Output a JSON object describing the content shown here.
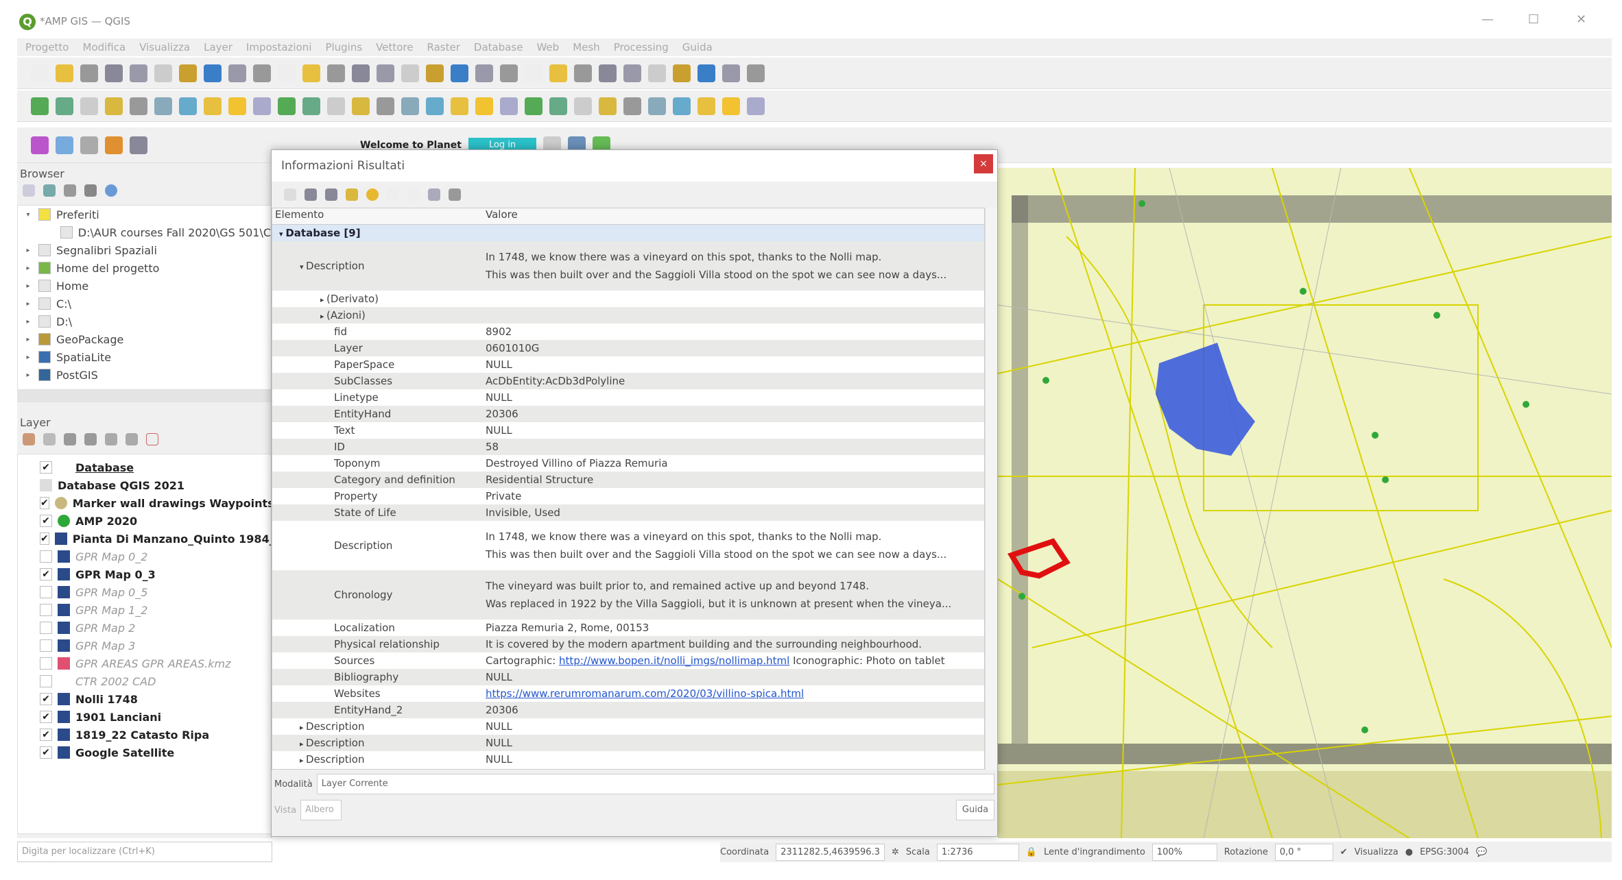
{
  "window": {
    "title": "*AMP GIS — QGIS"
  },
  "menu": [
    "Progetto",
    "Modifica",
    "Visualizza",
    "Layer",
    "Impostazioni",
    "Plugins",
    "Vettore",
    "Raster",
    "Database",
    "Web",
    "Mesh",
    "Processing",
    "Guida"
  ],
  "planet": {
    "welcome": "Welcome to Planet",
    "login": "Log in"
  },
  "browser": {
    "title": "Browser",
    "items": [
      {
        "label": "Preferiti",
        "expanded": true,
        "icon": "star-icon",
        "indent": 0
      },
      {
        "label": "D:\\AUR courses Fall 2020\\GS 501\\C",
        "icon": "folder-icon",
        "indent": 1
      },
      {
        "label": "Segnalibri Spaziali",
        "icon": "bookmark-icon",
        "indent": 0
      },
      {
        "label": "Home del progetto",
        "icon": "project-home-icon",
        "indent": 0
      },
      {
        "label": "Home",
        "icon": "home-icon",
        "indent": 0
      },
      {
        "label": "C:\\",
        "icon": "folder-icon",
        "indent": 0
      },
      {
        "label": "D:\\",
        "icon": "folder-icon",
        "indent": 0
      },
      {
        "label": "GeoPackage",
        "icon": "geopackage-icon",
        "indent": 0
      },
      {
        "label": "SpatiaLite",
        "icon": "spatialite-icon",
        "indent": 0
      },
      {
        "label": "PostGIS",
        "icon": "postgis-icon",
        "indent": 0
      }
    ]
  },
  "layers": {
    "title": "Layer",
    "items": [
      {
        "label": "Database",
        "checked": true,
        "active": true
      },
      {
        "label": "Database QGIS 2021",
        "checked": null
      },
      {
        "label": "Marker wall drawings Waypoints",
        "checked": true
      },
      {
        "label": "AMP 2020",
        "checked": true
      },
      {
        "label": "Pianta Di Manzano_Quinto 1984_",
        "checked": true
      },
      {
        "label": "GPR Map 0_2",
        "checked": false
      },
      {
        "label": "GPR Map 0_3",
        "checked": true
      },
      {
        "label": "GPR Map 0_5",
        "checked": false
      },
      {
        "label": "GPR Map 1_2",
        "checked": false
      },
      {
        "label": "GPR Map 2",
        "checked": false
      },
      {
        "label": "GPR Map 3",
        "checked": false
      },
      {
        "label": "GPR AREAS GPR AREAS.kmz",
        "checked": false
      },
      {
        "label": "CTR 2002 CAD",
        "checked": false
      },
      {
        "label": "Nolli 1748",
        "checked": true
      },
      {
        "label": "1901 Lanciani",
        "checked": true
      },
      {
        "label": "1819_22 Catasto Ripa",
        "checked": true
      },
      {
        "label": "Google Satellite",
        "checked": true
      }
    ]
  },
  "search": {
    "placeholder": "Digita per localizzare (Ctrl+K)"
  },
  "identify": {
    "title": "Informazioni Risultati",
    "close": "×",
    "col_element": "Elemento",
    "col_value": "Valore",
    "rows": [
      {
        "k": "Database  [9]",
        "v": "",
        "sel": true,
        "arrow": "▾",
        "indent": 0
      },
      {
        "k": "Description",
        "v": "In 1748, we know there was a vineyard on this spot, thanks to the Nolli map.",
        "v2": "This was then built over and the Saggioli Villa stood on the spot we can see now a days...",
        "arrow": "▾",
        "indent": 1
      },
      {
        "k": "(Derivato)",
        "v": "",
        "arrow": "▸",
        "indent": 2
      },
      {
        "k": "(Azioni)",
        "v": "",
        "arrow": "▸",
        "indent": 2
      },
      {
        "k": "fid",
        "v": "8902",
        "indent": 3
      },
      {
        "k": "Layer",
        "v": "0601010G",
        "indent": 3
      },
      {
        "k": "PaperSpace",
        "v": "NULL",
        "indent": 3
      },
      {
        "k": "SubClasses",
        "v": "AcDbEntity:AcDb3dPolyline",
        "indent": 3
      },
      {
        "k": "Linetype",
        "v": "NULL",
        "indent": 3
      },
      {
        "k": "EntityHand",
        "v": "20306",
        "indent": 3
      },
      {
        "k": "Text",
        "v": "NULL",
        "indent": 3
      },
      {
        "k": "ID",
        "v": "58",
        "indent": 3
      },
      {
        "k": "Toponym",
        "v": "Destroyed Villino of Piazza Remuria",
        "indent": 3
      },
      {
        "k": "Category and definition",
        "v": "Residential Structure",
        "indent": 3
      },
      {
        "k": "Property",
        "v": "Private",
        "indent": 3
      },
      {
        "k": "State of Life",
        "v": "Invisible, Used",
        "indent": 3
      },
      {
        "k": "Description",
        "v": "In 1748, we know there was a vineyard on this spot, thanks to the Nolli map.",
        "v2": "This was then built over and the Saggioli Villa stood on the spot we can see now a days...",
        "indent": 3
      },
      {
        "k": "Chronology",
        "v": "The vineyard was built prior to, and remained active up and beyond 1748.",
        "v2": "Was replaced in 1922 by the Villa Saggioli, but it is unknown at present when the vineya...",
        "indent": 3
      },
      {
        "k": "Localization",
        "v": "Piazza Remuria 2, Rome, 00153",
        "indent": 3
      },
      {
        "k": "Physical relationship",
        "v": "It is covered by the modern apartment building and the surrounding neighbourhood.",
        "indent": 3
      },
      {
        "k": "Sources",
        "v": "Cartographic: ",
        "link": "http://www.bopen.it/nolli_imgs/nollimap.html",
        "v3": " Iconographic: Photo on tablet",
        "indent": 3
      },
      {
        "k": "Bibliography",
        "v": "NULL",
        "indent": 3
      },
      {
        "k": "Websites",
        "v": "",
        "link": "https://www.rerumromanarum.com/2020/03/villino-spica.html",
        "indent": 3
      },
      {
        "k": "EntityHand_2",
        "v": "20306",
        "indent": 3
      },
      {
        "k": "Description",
        "v": "NULL",
        "arrow": "▸",
        "indent": 1
      },
      {
        "k": "Description",
        "v": "NULL",
        "arrow": "▸",
        "indent": 1
      },
      {
        "k": "Description",
        "v": "NULL",
        "arrow": "▸",
        "indent": 1
      }
    ],
    "mode_label": "Modalità",
    "mode_value": "Layer Corrente",
    "view_label": "Vista",
    "view_value": "Albero",
    "help": "Guida"
  },
  "status": {
    "coord_label": "Coordinata",
    "coord_value": "2311282.5,4639596.3",
    "scale_label": "Scala",
    "scale_value": "1:2736",
    "magnifier_label": "Lente d'ingrandimento",
    "magnifier_value": "100%",
    "rotation_label": "Rotazione",
    "rotation_value": "0,0 °",
    "render_label": "Visualizza",
    "crs": "EPSG:3004"
  },
  "colors": {
    "accent": "#5b9c2f",
    "close": "#d43b3b",
    "link": "#2255cc",
    "map_bg": "#eef2b8"
  }
}
